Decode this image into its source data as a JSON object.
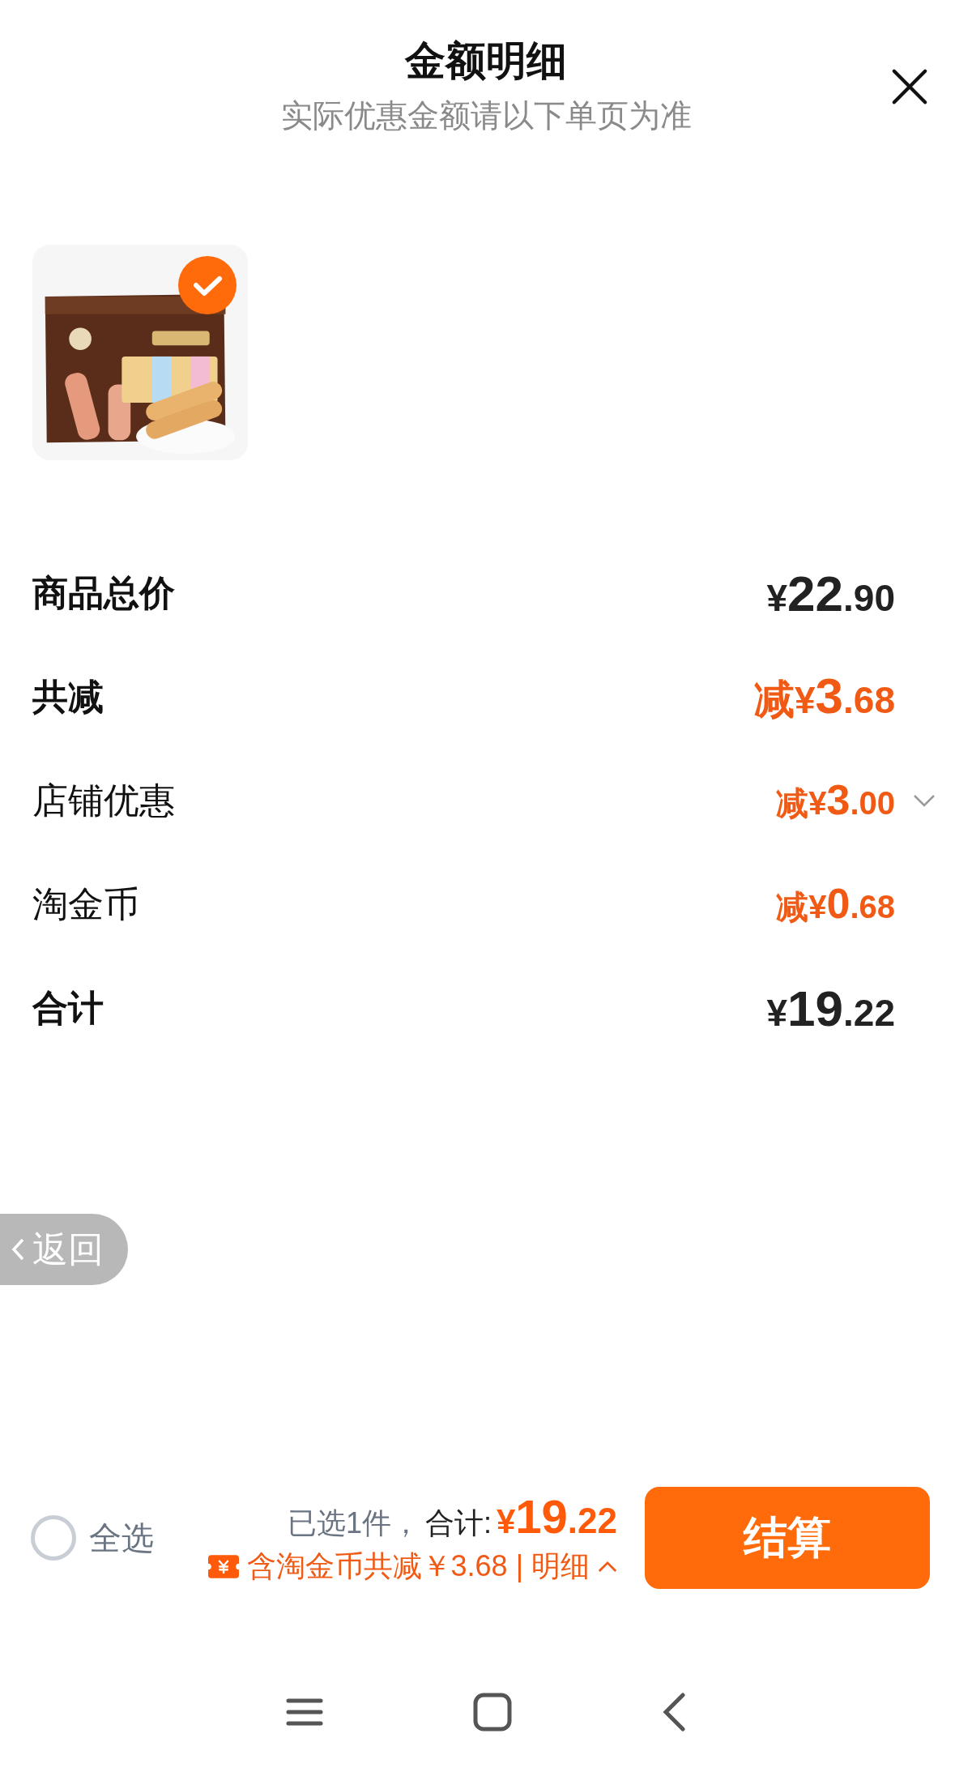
{
  "header": {
    "title": "金额明细",
    "subtitle": "实际优惠金额请以下单页为准"
  },
  "products": [
    {
      "kind": "picture",
      "selected": true
    }
  ],
  "rows": [
    {
      "label": "商品总价",
      "kind": "summary",
      "color": "#222222",
      "prefix": "",
      "symbol": "¥",
      "integer": "22",
      "fraction": ".90"
    },
    {
      "label": "共减",
      "kind": "summary",
      "color": "#f05a14",
      "prefix": "减",
      "symbol": "¥",
      "integer": "3",
      "fraction": ".68"
    },
    {
      "label": "店铺优惠",
      "kind": "detail",
      "color": "#f05a14",
      "prefix": "减",
      "symbol": "¥",
      "integer": "3",
      "fraction": ".00",
      "expanded": false
    },
    {
      "label": "淘金币",
      "kind": "detail",
      "color": "#f05a14",
      "prefix": "减",
      "symbol": "¥",
      "integer": "0",
      "fraction": ".68"
    },
    {
      "label": "合计",
      "kind": "summary",
      "color": "#222222",
      "prefix": "",
      "symbol": "¥",
      "integer": "19",
      "fraction": ".22"
    }
  ],
  "back_button": {
    "label": "返回"
  },
  "checkout_bar": {
    "select_all": {
      "label": "全选",
      "checked": false
    },
    "selected_count": "已选1件，",
    "total_label": "合计:",
    "total": {
      "symbol": "¥",
      "integer": "19",
      "fraction": ".22"
    },
    "savings": "含淘金币共减￥3.68 | 明细",
    "details_expanded": true,
    "checkout_button": "结算"
  }
}
